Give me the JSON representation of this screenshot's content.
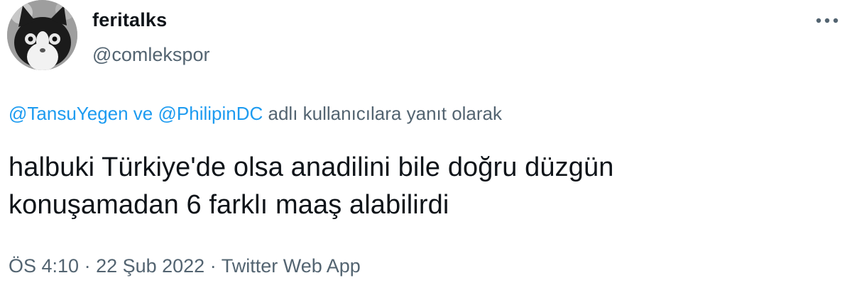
{
  "tweet": {
    "author": {
      "display_name": "feritalks",
      "handle": "@comlekspor"
    },
    "more_icon": "more-horizontal-icon",
    "reply": {
      "mention_1": "@TansuYegen",
      "connector": " ve ",
      "mention_2": "@PhilipinDC",
      "suffix": " adlı kullanıcılara yanıt olarak"
    },
    "text_line_1": "halbuki Türkiye'de olsa anadilini bile doğru düzgün",
    "text_line_2": "konuşamadan 6 farklı maaş alabilirdi",
    "meta": {
      "time": "ÖS 4:10",
      "separator": " · ",
      "date": "22 Şub 2022",
      "source": "Twitter Web App"
    }
  },
  "colors": {
    "text": "#0f1419",
    "secondary": "#536471",
    "link": "#1d9bf0"
  }
}
